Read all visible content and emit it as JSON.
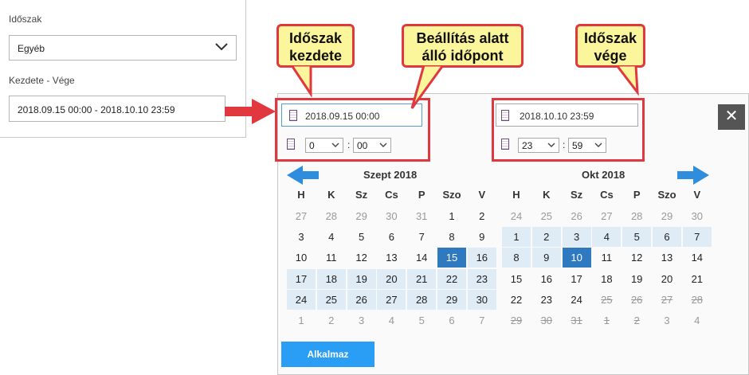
{
  "filters": {
    "period_label": "Időszak",
    "period_value": "Egyéb",
    "range_label": "Kezdete - Vége",
    "range_value": "2018.09.15 00:00 - 2018.10.10 23:59"
  },
  "start": {
    "date": "2018.09.15 00:00",
    "hour": "0",
    "minute": "00"
  },
  "end": {
    "date": "2018.10.10 23:59",
    "hour": "23",
    "minute": "59"
  },
  "close_symbol": "✕",
  "apply_label": "Alkalmaz",
  "callouts": {
    "start": "Időszak kezdete",
    "current": "Beállítás alatt álló időpont",
    "end": "Időszak vége"
  },
  "weekdays": [
    "H",
    "K",
    "Sz",
    "Cs",
    "P",
    "Szo",
    "V"
  ],
  "months": [
    {
      "title": "Szept 2018",
      "weeks": [
        [
          {
            "d": "27",
            "s": "muted"
          },
          {
            "d": "28",
            "s": "muted"
          },
          {
            "d": "29",
            "s": "muted"
          },
          {
            "d": "30",
            "s": "muted"
          },
          {
            "d": "31",
            "s": "muted"
          },
          {
            "d": "1",
            "s": ""
          },
          {
            "d": "2",
            "s": ""
          }
        ],
        [
          {
            "d": "3",
            "s": ""
          },
          {
            "d": "4",
            "s": ""
          },
          {
            "d": "5",
            "s": ""
          },
          {
            "d": "6",
            "s": ""
          },
          {
            "d": "7",
            "s": ""
          },
          {
            "d": "8",
            "s": ""
          },
          {
            "d": "9",
            "s": ""
          }
        ],
        [
          {
            "d": "10",
            "s": ""
          },
          {
            "d": "11",
            "s": ""
          },
          {
            "d": "12",
            "s": ""
          },
          {
            "d": "13",
            "s": ""
          },
          {
            "d": "14",
            "s": ""
          },
          {
            "d": "15",
            "s": "sel"
          },
          {
            "d": "16",
            "s": "hl"
          }
        ],
        [
          {
            "d": "17",
            "s": "hl"
          },
          {
            "d": "18",
            "s": "hl"
          },
          {
            "d": "19",
            "s": "hl"
          },
          {
            "d": "20",
            "s": "hl"
          },
          {
            "d": "21",
            "s": "hl"
          },
          {
            "d": "22",
            "s": "hl"
          },
          {
            "d": "23",
            "s": "hl"
          }
        ],
        [
          {
            "d": "24",
            "s": "hl"
          },
          {
            "d": "25",
            "s": "hl"
          },
          {
            "d": "26",
            "s": "hl"
          },
          {
            "d": "27",
            "s": "hl"
          },
          {
            "d": "28",
            "s": "hl"
          },
          {
            "d": "29",
            "s": "hl"
          },
          {
            "d": "30",
            "s": "hl"
          }
        ],
        [
          {
            "d": "1",
            "s": "muted"
          },
          {
            "d": "2",
            "s": "muted"
          },
          {
            "d": "3",
            "s": "muted"
          },
          {
            "d": "4",
            "s": "muted"
          },
          {
            "d": "5",
            "s": "muted"
          },
          {
            "d": "6",
            "s": "muted"
          },
          {
            "d": "7",
            "s": "muted"
          }
        ]
      ]
    },
    {
      "title": "Okt 2018",
      "weeks": [
        [
          {
            "d": "24",
            "s": "muted"
          },
          {
            "d": "25",
            "s": "muted"
          },
          {
            "d": "26",
            "s": "muted"
          },
          {
            "d": "27",
            "s": "muted"
          },
          {
            "d": "28",
            "s": "muted"
          },
          {
            "d": "29",
            "s": "muted"
          },
          {
            "d": "30",
            "s": "muted"
          }
        ],
        [
          {
            "d": "1",
            "s": "hl"
          },
          {
            "d": "2",
            "s": "hl"
          },
          {
            "d": "3",
            "s": "hl"
          },
          {
            "d": "4",
            "s": "hl"
          },
          {
            "d": "5",
            "s": "hl"
          },
          {
            "d": "6",
            "s": "hl"
          },
          {
            "d": "7",
            "s": "hl"
          }
        ],
        [
          {
            "d": "8",
            "s": "hl"
          },
          {
            "d": "9",
            "s": "hl"
          },
          {
            "d": "10",
            "s": "sel"
          },
          {
            "d": "11",
            "s": ""
          },
          {
            "d": "12",
            "s": ""
          },
          {
            "d": "13",
            "s": ""
          },
          {
            "d": "14",
            "s": ""
          }
        ],
        [
          {
            "d": "15",
            "s": ""
          },
          {
            "d": "16",
            "s": ""
          },
          {
            "d": "17",
            "s": ""
          },
          {
            "d": "18",
            "s": ""
          },
          {
            "d": "19",
            "s": ""
          },
          {
            "d": "20",
            "s": ""
          },
          {
            "d": "21",
            "s": ""
          }
        ],
        [
          {
            "d": "22",
            "s": ""
          },
          {
            "d": "23",
            "s": ""
          },
          {
            "d": "24",
            "s": ""
          },
          {
            "d": "25",
            "s": "strike"
          },
          {
            "d": "26",
            "s": "strike"
          },
          {
            "d": "27",
            "s": "strike"
          },
          {
            "d": "28",
            "s": "strike"
          }
        ],
        [
          {
            "d": "29",
            "s": "strike"
          },
          {
            "d": "30",
            "s": "strike"
          },
          {
            "d": "31",
            "s": "strike"
          },
          {
            "d": "1",
            "s": "strike"
          },
          {
            "d": "2",
            "s": "strike"
          },
          {
            "d": "3",
            "s": "muted"
          },
          {
            "d": "4",
            "s": "muted"
          }
        ]
      ]
    }
  ],
  "colors": {
    "selected": "#2e79c0",
    "range_highlight": "#dfecf6",
    "annotation_red": "#e0383e",
    "callout_yellow": "#fbf59b",
    "apply_button": "#2a9df4",
    "nav_arrow": "#2e8ddc"
  },
  "icons": [
    "chevron-down-icon",
    "calendar-icon",
    "close-icon",
    "prev-month-arrow-icon",
    "next-month-arrow-icon"
  ]
}
